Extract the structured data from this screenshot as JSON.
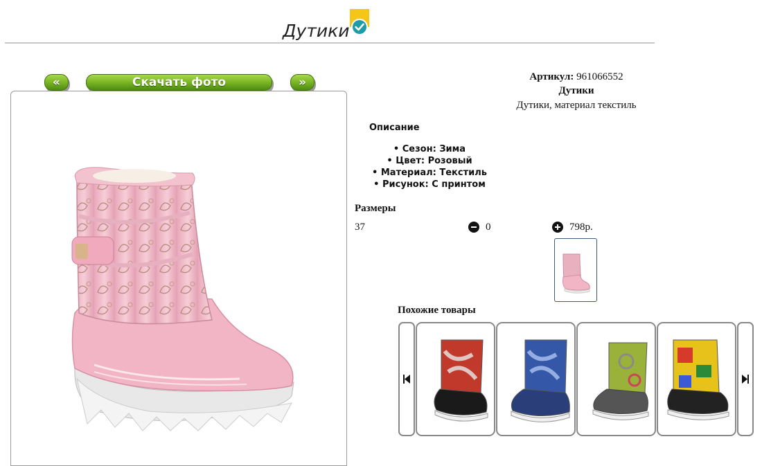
{
  "header": {
    "title": "Дутики"
  },
  "gallery": {
    "prev_label": "«",
    "download_label": "Скачать фото",
    "next_label": "»"
  },
  "product": {
    "article_label": "Артикул:",
    "article_value": "961066552",
    "name": "Дутики",
    "subtitle": "Дутики, материал текстиль",
    "description_heading": "Описание",
    "features": [
      "Сезон: Зима",
      "Цвет: Розовый",
      "Материал: Текстиль",
      "Рисунок: С принтом"
    ]
  },
  "sizes": {
    "heading": "Размеры",
    "rows": [
      {
        "size": "37",
        "quantity": "0",
        "price": "798р."
      }
    ]
  },
  "similar": {
    "heading": "Похожие товары",
    "items": [
      {
        "colors": [
          "#c0392b",
          "#e8e8e8"
        ]
      },
      {
        "colors": [
          "#3457a8",
          "#9fb7e8"
        ]
      },
      {
        "colors": [
          "#9bb23a",
          "#8a8a8a"
        ]
      },
      {
        "colors": [
          "#e6c21a",
          "#d63a2a"
        ]
      }
    ]
  },
  "colors": {
    "accent_green": "#79b524",
    "badge_yellow": "#f5c518",
    "badge_teal": "#1e9aa8",
    "boot_pink": "#f2b8c8"
  }
}
